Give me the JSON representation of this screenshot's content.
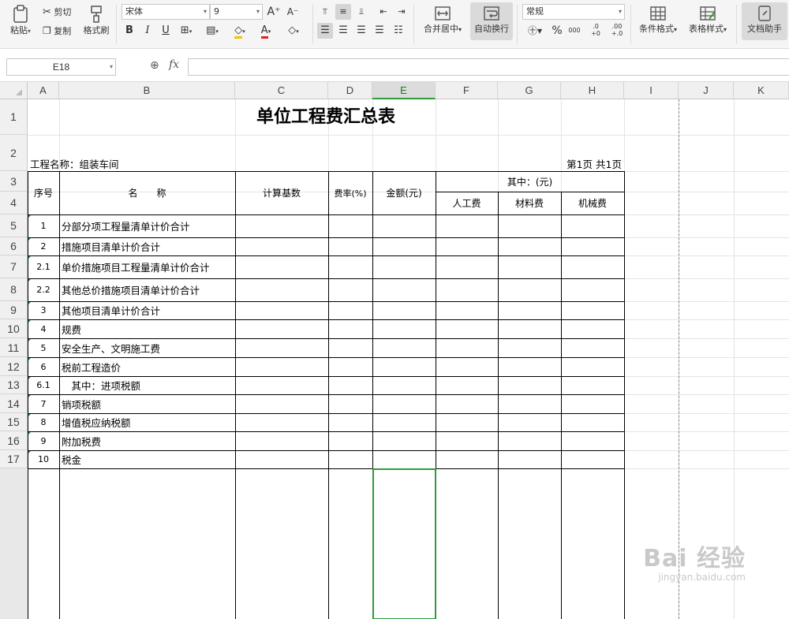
{
  "toolbar": {
    "paste": "粘贴",
    "cut": "剪切",
    "copy": "复制",
    "format_painter": "格式刷",
    "font_name": "宋体",
    "font_size": "9",
    "merge_center": "合并居中",
    "wrap_text": "自动换行",
    "number_format": "常规",
    "conditional_format": "条件格式",
    "table_style": "表格样式",
    "doc_assistant": "文档助手",
    "percent_symbol": "%",
    "thousands_symbol": "000",
    "inc_decimal": ".0 +0",
    "dec_decimal": ".00 +.0"
  },
  "formula_bar": {
    "cell_ref": "E18",
    "fx": "fx",
    "value": ""
  },
  "columns": [
    "A",
    "B",
    "C",
    "D",
    "E",
    "F",
    "G",
    "H",
    "I",
    "J",
    "K"
  ],
  "selected_column": "E",
  "selected_cell": "E18",
  "rows": [
    "1",
    "2",
    "3",
    "4",
    "5",
    "6",
    "7",
    "8",
    "9",
    "10",
    "11",
    "12",
    "13",
    "14",
    "15",
    "16",
    "17"
  ],
  "sheet": {
    "title": "单位工程费汇总表",
    "project_name": "工程名称：组装车间",
    "page_info": "第1页 共1页",
    "headers": {
      "seq": "序号",
      "name": "名　　称",
      "base": "计算基数",
      "rate": "费率(%)",
      "amount": "金额(元)",
      "of_which": "其中：(元)",
      "labor": "人工费",
      "material": "材料费",
      "machine": "机械费"
    },
    "items": [
      {
        "seq": "1",
        "name": "分部分项工程量清单计价合计"
      },
      {
        "seq": "2",
        "name": "措施项目清单计价合计"
      },
      {
        "seq": "2.1",
        "name": "单价措施项目工程量清单计价合计"
      },
      {
        "seq": "2.2",
        "name": "其他总价措施项目清单计价合计"
      },
      {
        "seq": "3",
        "name": "其他项目清单计价合计"
      },
      {
        "seq": "4",
        "name": "规费"
      },
      {
        "seq": "5",
        "name": "安全生产、文明施工费"
      },
      {
        "seq": "6",
        "name": "税前工程造价"
      },
      {
        "seq": "6.1",
        "name": "　其中：进项税额"
      },
      {
        "seq": "7",
        "name": "销项税额"
      },
      {
        "seq": "8",
        "name": "增值税应纳税额"
      },
      {
        "seq": "9",
        "name": "附加税费"
      },
      {
        "seq": "10",
        "name": "税金"
      }
    ]
  },
  "watermark": {
    "brand": "Bai  经验",
    "url": "jingyan.baidu.com"
  }
}
